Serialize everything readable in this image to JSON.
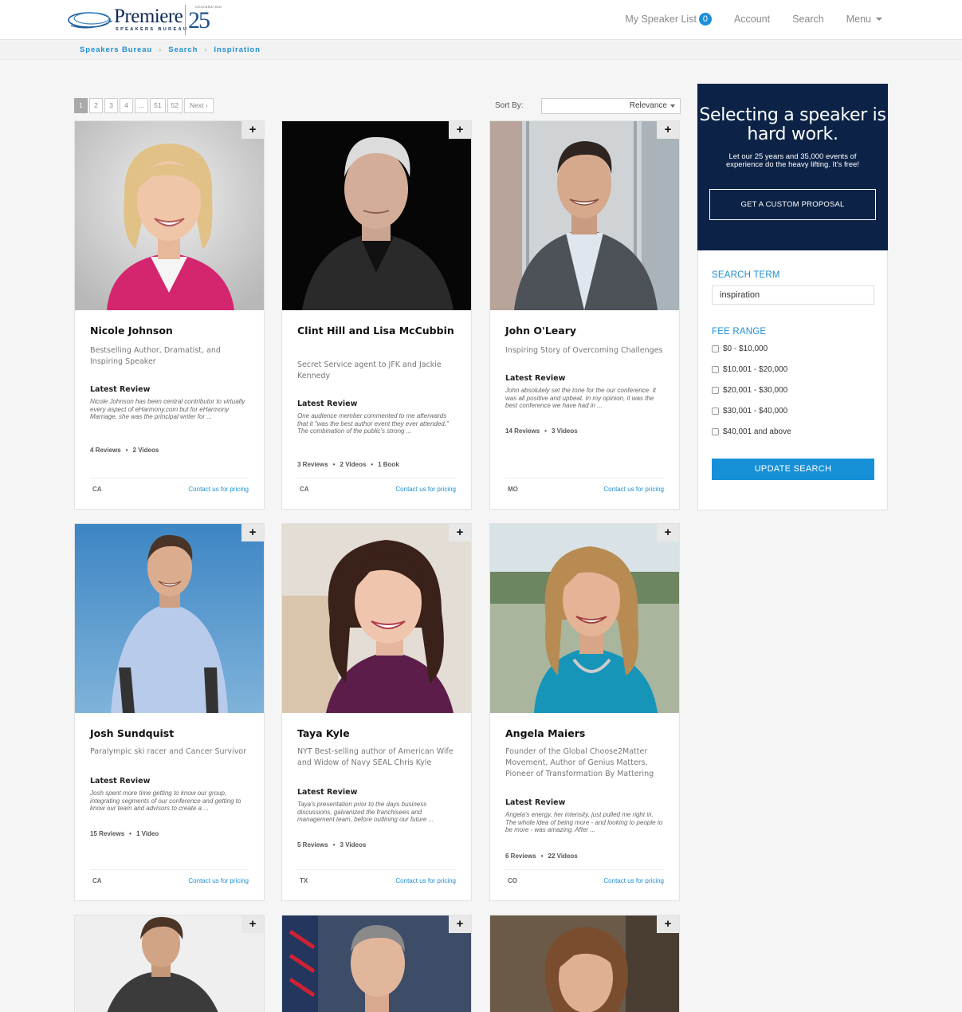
{
  "header": {
    "logo": {
      "word": "Premiere",
      "sub": "SPEAKERS BUREAU",
      "anniversary": "25",
      "celebrating": "CELEBRATING"
    },
    "nav": {
      "speaker_list": "My Speaker List",
      "speaker_list_count": "0",
      "account": "Account",
      "search": "Search",
      "menu": "Menu"
    }
  },
  "breadcrumb": [
    "Speakers Bureau",
    "Search",
    "Inspiration"
  ],
  "pagination": {
    "pages": [
      "1",
      "2",
      "3",
      "4",
      "...",
      "51",
      "52"
    ],
    "next": "Next ›",
    "current": "1"
  },
  "sort": {
    "label": "Sort By:",
    "value": "Relevance"
  },
  "speakers": [
    {
      "name": "Nicole Johnson",
      "description": "Bestselling Author, Dramatist, and Inspiring Speaker",
      "review_title": "Latest Review",
      "review": "Nicole Johnson has been central contributor to virtually every aspect of eHarmony.com but for eHarmony Marriage, she was the principal writer for ...",
      "stats": [
        "4 Reviews",
        "2 Videos"
      ],
      "state": "CA",
      "pricing": "Contact us for pricing"
    },
    {
      "name": "Clint Hill and Lisa McCubbin",
      "description": "Secret Service agent to JFK and Jackie Kennedy",
      "review_title": "Latest Review",
      "review": "One audience member commented to me afterwards that it \"was the best author event they ever attended.\" The combination of the public's strong ...",
      "stats": [
        "3 Reviews",
        "2 Videos",
        "1 Book"
      ],
      "state": "CA",
      "pricing": "Contact us for pricing"
    },
    {
      "name": "John O'Leary",
      "description": "Inspiring Story of Overcoming Challenges",
      "review_title": "Latest Review",
      "review": "John absolutely set the tone for the our conference. It was all positive and upbeat. In my opinion, it was the best conference we have had in ...",
      "stats": [
        "14 Reviews",
        "3 Videos"
      ],
      "state": "MO",
      "pricing": "Contact us for pricing"
    },
    {
      "name": "Josh Sundquist",
      "description": "Paralympic ski racer and Cancer Survivor",
      "review_title": "Latest Review",
      "review": "Josh spent more time getting to know our group, integrating segments of our conference and getting to know our team and advisors to create a ...",
      "stats": [
        "15 Reviews",
        "1 Video"
      ],
      "state": "CA",
      "pricing": "Contact us for pricing"
    },
    {
      "name": "Taya Kyle",
      "description": "NYT Best-selling author of American Wife and Widow of Navy SEAL Chris Kyle",
      "review_title": "Latest Review",
      "review": "Taya's presentation prior to the days business discussions, galvanized the franchisees and management team, before outlining our future ...",
      "stats": [
        "5 Reviews",
        "3 Videos"
      ],
      "state": "TX",
      "pricing": "Contact us for pricing"
    },
    {
      "name": "Angela Maiers",
      "description": "Founder of the Global Choose2Matter Movement, Author of Genius Matters, Pioneer of Transformation By Mattering",
      "review_title": "Latest Review",
      "review": "Angela's energy, her intensity, just pulled me right in. The whole idea of being more - and looking to people to be more - was amazing. After ...",
      "stats": [
        "6 Reviews",
        "22 Videos"
      ],
      "state": "CO",
      "pricing": "Contact us for pricing"
    }
  ],
  "plus_label": "+",
  "promo": {
    "title": "Selecting a speaker is hard work.",
    "subtitle": "Let our 25 years and 35,000 events of experience do the heavy lifting. It's free!",
    "button": "GET A CUSTOM PROPOSAL"
  },
  "filters": {
    "search_label": "SEARCH TERM",
    "search_value": "inspiration",
    "fee_label": "FEE RANGE",
    "fee_options": [
      "$0 - $10,000",
      "$10,001 - $20,000",
      "$20,001 - $30,000",
      "$30,001 - $40,000",
      "$40,001 and above"
    ],
    "update_button": "UPDATE SEARCH"
  },
  "colors": {
    "accent": "#1f8fd0",
    "promo_bg": "#0c2347",
    "button": "#1691d8"
  }
}
